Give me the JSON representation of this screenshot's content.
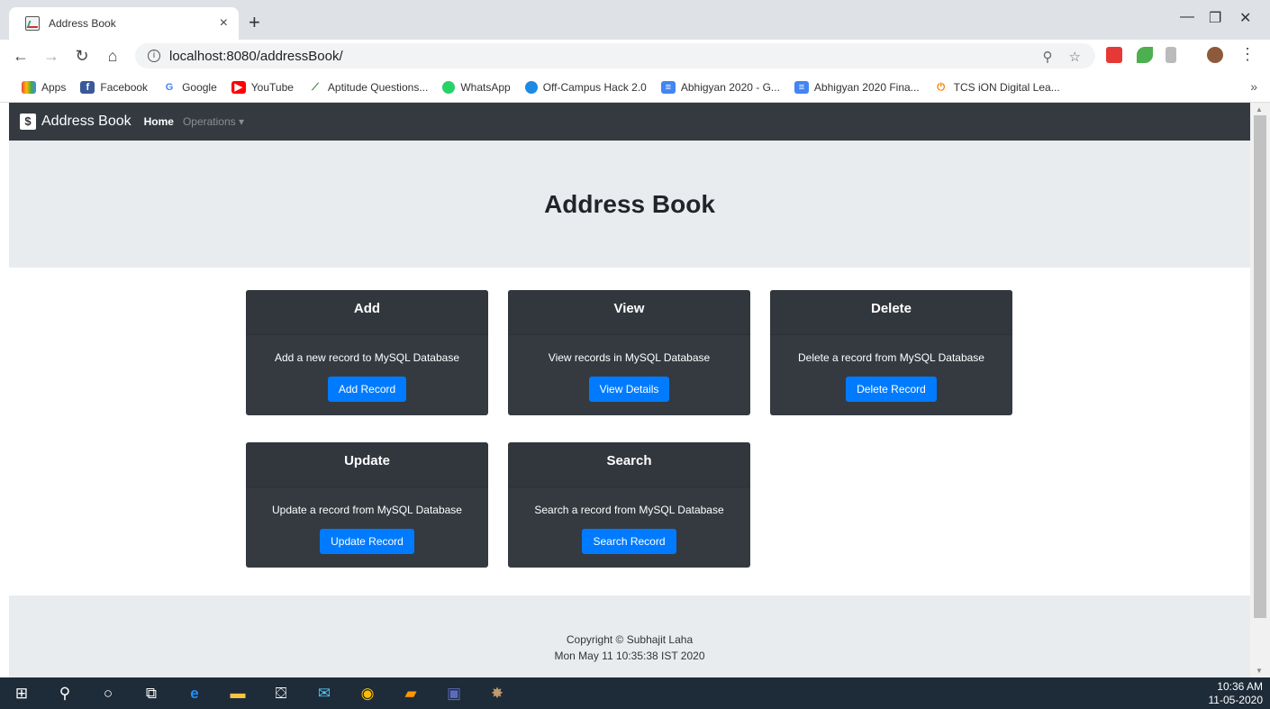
{
  "browser": {
    "tab_title": "Address Book",
    "tab_close": "×",
    "new_tab": "+",
    "url": "localhost:8080/addressBook/",
    "minimize": "—",
    "restore": "❐",
    "close": "✕"
  },
  "bookmarks": [
    {
      "label": "Apps",
      "icon": "apps-icon",
      "color": "#e44"
    },
    {
      "label": "Facebook",
      "icon": "facebook-icon",
      "color": "#3b5998"
    },
    {
      "label": "Google",
      "icon": "google-icon",
      "color": "#4285f4"
    },
    {
      "label": "YouTube",
      "icon": "youtube-icon",
      "color": "#ff0000"
    },
    {
      "label": "Aptitude Questions...",
      "icon": "aptitude-icon",
      "color": "#2e7d32"
    },
    {
      "label": "WhatsApp",
      "icon": "whatsapp-icon",
      "color": "#25d366"
    },
    {
      "label": "Off-Campus Hack 2.0",
      "icon": "hack-icon",
      "color": "#1e88e5"
    },
    {
      "label": "Abhigyan 2020 - G...",
      "icon": "docs-icon",
      "color": "#4285f4"
    },
    {
      "label": "Abhigyan 2020 Fina...",
      "icon": "docs-icon",
      "color": "#4285f4"
    },
    {
      "label": "TCS iON Digital Lea...",
      "icon": "tcs-icon",
      "color": "#f57c00"
    }
  ],
  "bookmarks_more": "»",
  "navbar": {
    "brand_icon": "$",
    "brand": "Address Book",
    "home": "Home",
    "operations": "Operations ▾"
  },
  "jumbotron": {
    "title": "Address Book"
  },
  "cards": [
    {
      "title": "Add",
      "desc": "Add a new record to MySQL Database",
      "button": "Add Record"
    },
    {
      "title": "View",
      "desc": "View records in MySQL Database",
      "button": "View Details"
    },
    {
      "title": "Delete",
      "desc": "Delete a record from MySQL Database",
      "button": "Delete Record"
    },
    {
      "title": "Update",
      "desc": "Update a record from MySQL Database",
      "button": "Update Record"
    },
    {
      "title": "Search",
      "desc": "Search a record from MySQL Database",
      "button": "Search Record"
    }
  ],
  "footer": {
    "copyright": "Copyright © Subhajit Laha",
    "date": "Mon May 11 10:35:38 IST 2020"
  },
  "taskbar": {
    "time": "10:36 AM",
    "date": "11-05-2020"
  },
  "colors": {
    "navbar": "#343a40",
    "accent": "#007bff",
    "jumbotron": "#e9ecef"
  }
}
